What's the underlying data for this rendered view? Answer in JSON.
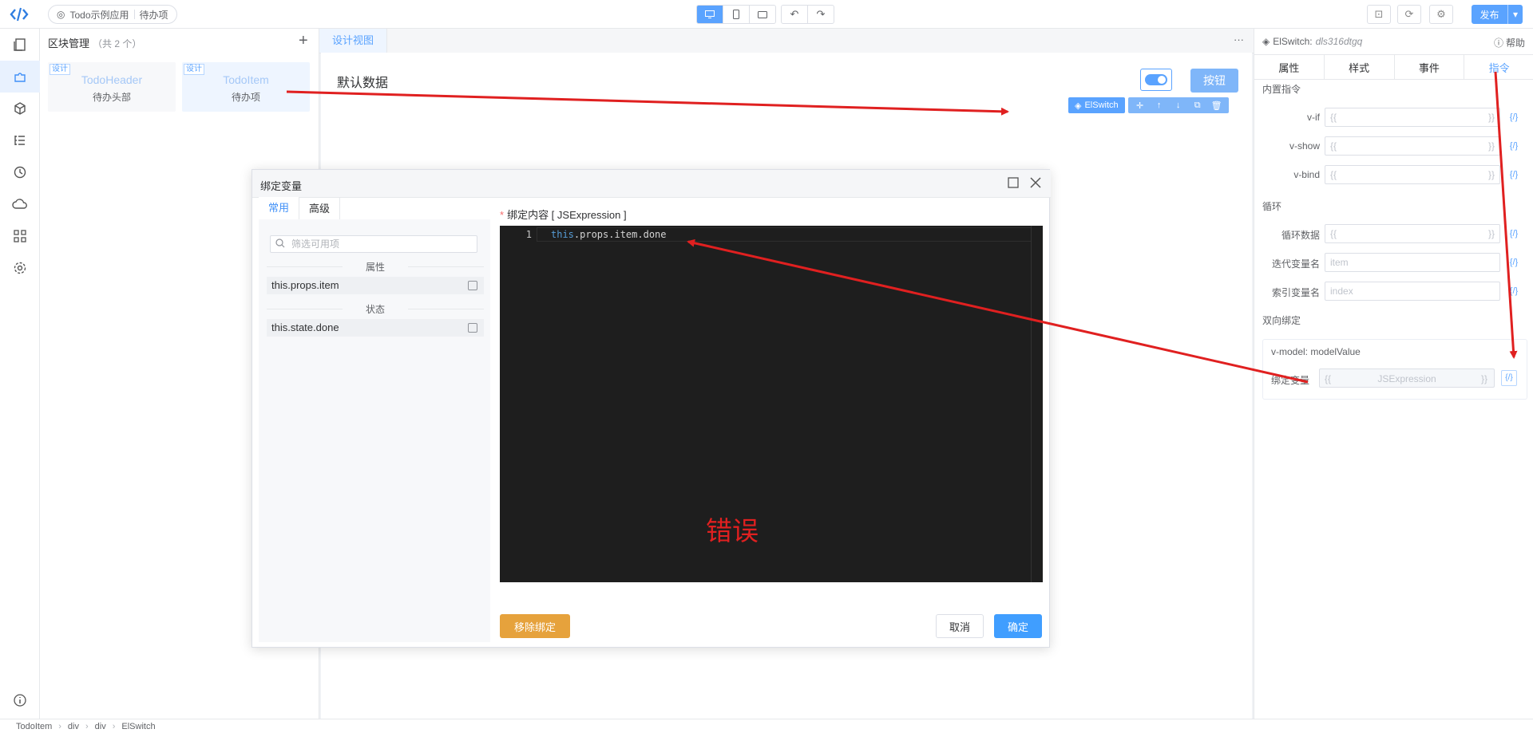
{
  "topbar": {
    "app_name": "Todo示例应用",
    "page_name": "待办项",
    "publish_label": "发布"
  },
  "blocks": {
    "title": "区块管理",
    "count": "（共 2 个）",
    "items": [
      {
        "tag": "设计",
        "name": "TodoHeader",
        "desc": "待办头部"
      },
      {
        "tag": "设计",
        "name": "TodoItem",
        "desc": "待办项"
      }
    ]
  },
  "canvas": {
    "tab": "设计视图",
    "default_text": "默认数据",
    "button_label": "按钮",
    "selected_component": "ElSwitch"
  },
  "right_panel": {
    "component": "ElSwitch:",
    "component_id": "dls316dtgq",
    "help": "帮助",
    "tabs": [
      "属性",
      "样式",
      "事件",
      "指令"
    ],
    "sec_builtin": "内置指令",
    "directives": [
      {
        "label": "v-if",
        "value": "{{",
        "right": "}}"
      },
      {
        "label": "v-show",
        "value": "{{",
        "right": "}}"
      },
      {
        "label": "v-bind",
        "value": "{{",
        "right": "}}"
      }
    ],
    "sec_loop": "循环",
    "loop_rows": [
      {
        "label": "循环数据",
        "value": "{{",
        "right": "}}"
      },
      {
        "label": "迭代变量名",
        "value": "item",
        "right": ""
      },
      {
        "label": "索引变量名",
        "value": "index",
        "right": ""
      }
    ],
    "sec_twoway": "双向绑定",
    "vmodel": "v-model: modelValue",
    "bind_label": "绑定变量",
    "bind_left": "{{",
    "bind_value": "JSExpression",
    "bind_right": "}}",
    "bind_icon": "{/}"
  },
  "modal": {
    "title": "绑定变量",
    "tabs": [
      "常用",
      "高级"
    ],
    "filter_placeholder": "筛选可用项",
    "group_props": "属性",
    "var_props": "this.props.item",
    "group_state": "状态",
    "var_state": "this.state.done",
    "content_label": "绑定内容 [ JSExpression ]",
    "line_no": "1",
    "code_kw": "this",
    "code_rest": ".props.item.done",
    "error_text": "错误",
    "remove_label": "移除绑定",
    "cancel_label": "取消",
    "ok_label": "确定"
  },
  "breadcrumb": [
    "TodoItem",
    "div",
    "div",
    "ElSwitch"
  ],
  "colors": {
    "accent": "#5aa3ff",
    "warning": "#e6a23c",
    "annotation": "#e02020"
  }
}
